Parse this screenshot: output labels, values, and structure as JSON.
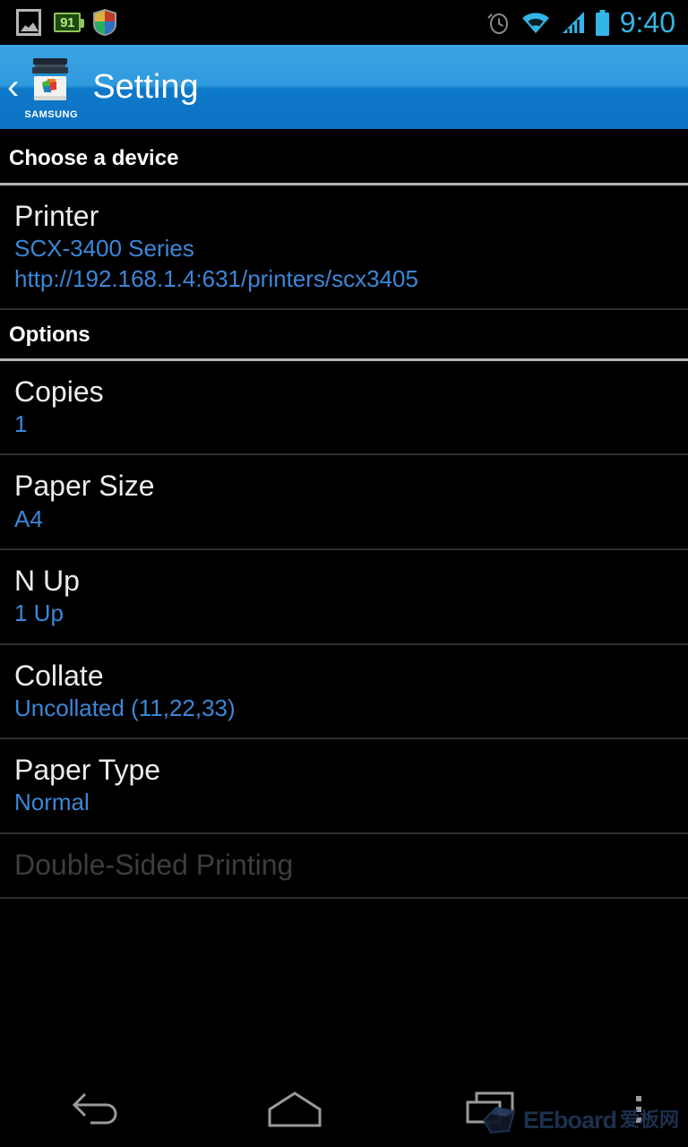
{
  "status_bar": {
    "left_icons": [
      {
        "name": "screenshot-icon",
        "label": "screenshot"
      },
      {
        "name": "battery-saver-icon",
        "label": "91"
      },
      {
        "name": "security-shield-icon",
        "label": "shield"
      }
    ],
    "right_icons": [
      {
        "name": "alarm-icon",
        "label": "alarm"
      },
      {
        "name": "wifi-icon",
        "label": "wifi"
      },
      {
        "name": "cellular-signal-icon",
        "label": "signal"
      },
      {
        "name": "battery-icon",
        "label": "battery"
      }
    ],
    "battery_level": "91",
    "time": "9:40",
    "time_color": "#33b5e5"
  },
  "action_bar": {
    "back_glyph": "‹",
    "app_icon": "samsung-printer-icon",
    "brand": "SAMSUNG",
    "title": "Setting",
    "background_top": "#3ba3e3",
    "background_bottom": "#0d72c3"
  },
  "accent_color": "#3b87d8",
  "sections": [
    {
      "header": "Choose a device",
      "items": [
        {
          "title": "Printer",
          "sub1": "SCX-3400 Series",
          "sub2": "http://192.168.1.4:631/printers/scx3405",
          "enabled": true
        }
      ]
    },
    {
      "header": "Options",
      "items": [
        {
          "title": "Copies",
          "sub1": "1",
          "enabled": true
        },
        {
          "title": "Paper Size",
          "sub1": "A4",
          "enabled": true
        },
        {
          "title": "N Up",
          "sub1": "1 Up",
          "enabled": true
        },
        {
          "title": "Collate",
          "sub1": "Uncollated (11,22,33)",
          "enabled": true
        },
        {
          "title": "Paper Type",
          "sub1": "Normal",
          "enabled": true
        },
        {
          "title": "Double-Sided Printing",
          "sub1": "",
          "enabled": false
        }
      ]
    }
  ],
  "nav_bar": {
    "buttons": [
      {
        "name": "back-button",
        "icon": "back-arrow-icon"
      },
      {
        "name": "home-button",
        "icon": "home-icon"
      },
      {
        "name": "recents-button",
        "icon": "recent-apps-icon"
      },
      {
        "name": "overflow-button",
        "icon": "more-vertical-icon"
      }
    ]
  },
  "watermark": {
    "text": "EEboard",
    "text_cn": "爱板网"
  }
}
